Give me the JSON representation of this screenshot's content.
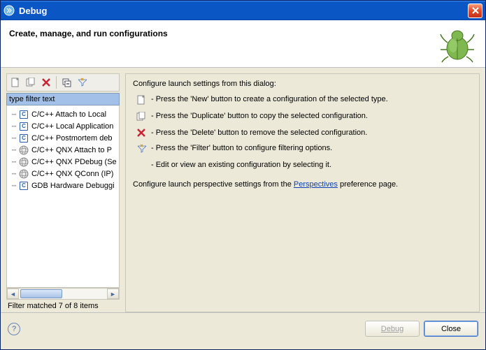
{
  "window": {
    "title": "Debug"
  },
  "header": {
    "heading": "Create, manage, and run configurations"
  },
  "left": {
    "filter_value": "type filter text",
    "items": [
      {
        "label": "C/C++ Attach to Local",
        "icon": "c-badge"
      },
      {
        "label": "C/C++ Local Application",
        "icon": "c-badge"
      },
      {
        "label": "C/C++ Postmortem deb",
        "icon": "c-badge"
      },
      {
        "label": "C/C++ QNX Attach to P",
        "icon": "sphere"
      },
      {
        "label": "C/C++ QNX PDebug (Se",
        "icon": "sphere"
      },
      {
        "label": "C/C++ QNX QConn (IP)",
        "icon": "sphere"
      },
      {
        "label": "GDB Hardware Debuggi",
        "icon": "c-badge"
      }
    ],
    "status": "Filter matched 7 of 8 items"
  },
  "right": {
    "intro": "Configure launch settings from this dialog:",
    "instructions": [
      {
        "icon": "new-icon",
        "text": "- Press the 'New' button to create a configuration of the selected type."
      },
      {
        "icon": "duplicate-icon",
        "text": "- Press the 'Duplicate' button to copy the selected configuration."
      },
      {
        "icon": "delete-icon",
        "text": "- Press the 'Delete' button to remove the selected configuration."
      },
      {
        "icon": "filter-icon",
        "text": "- Press the 'Filter' button to configure filtering options."
      },
      {
        "icon": "",
        "text": "- Edit or view an existing configuration by selecting it."
      }
    ],
    "persp_prefix": "Configure launch perspective settings from the ",
    "persp_link": "Perspectives",
    "persp_suffix": " preference page."
  },
  "footer": {
    "debug_label": "Debug",
    "close_label": "Close"
  }
}
